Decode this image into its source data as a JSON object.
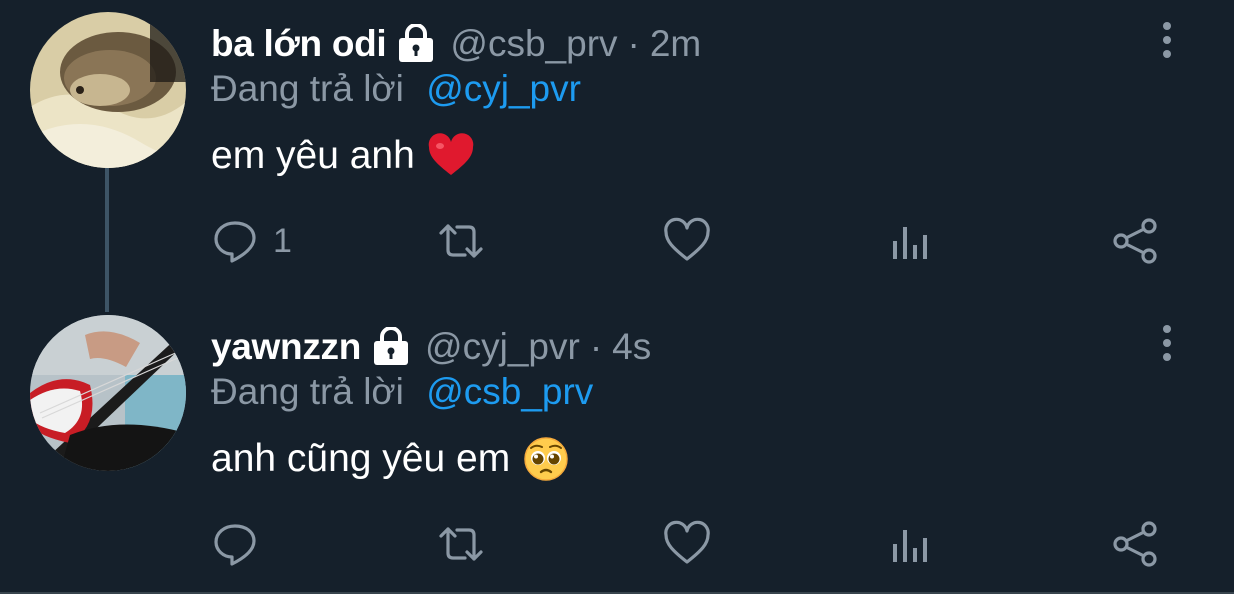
{
  "tweets": [
    {
      "display_name": "ba lớn odi",
      "handle": "@csb_prv",
      "separator": "·",
      "time": "2m",
      "reply_prefix": "Đang trả lời",
      "reply_to": "@cyj_pvr",
      "text": "em yêu anh",
      "emoji": "red-heart",
      "reply_count": "1",
      "avatar": "hedgehog-photo",
      "locked": true
    },
    {
      "display_name": "yawnzzn",
      "handle": "@cyj_pvr",
      "separator": "·",
      "time": "4s",
      "reply_prefix": "Đang trả lời",
      "reply_to": "@csb_prv",
      "text": "anh cũng yêu em",
      "emoji": "pleading-face",
      "reply_count": "",
      "avatar": "bass-guitar-photo",
      "locked": true
    }
  ],
  "colors": {
    "background": "#15202b",
    "text": "#ffffff",
    "muted": "#8b98a5",
    "link": "#1d9bf0",
    "thread_line": "#3d5466"
  }
}
